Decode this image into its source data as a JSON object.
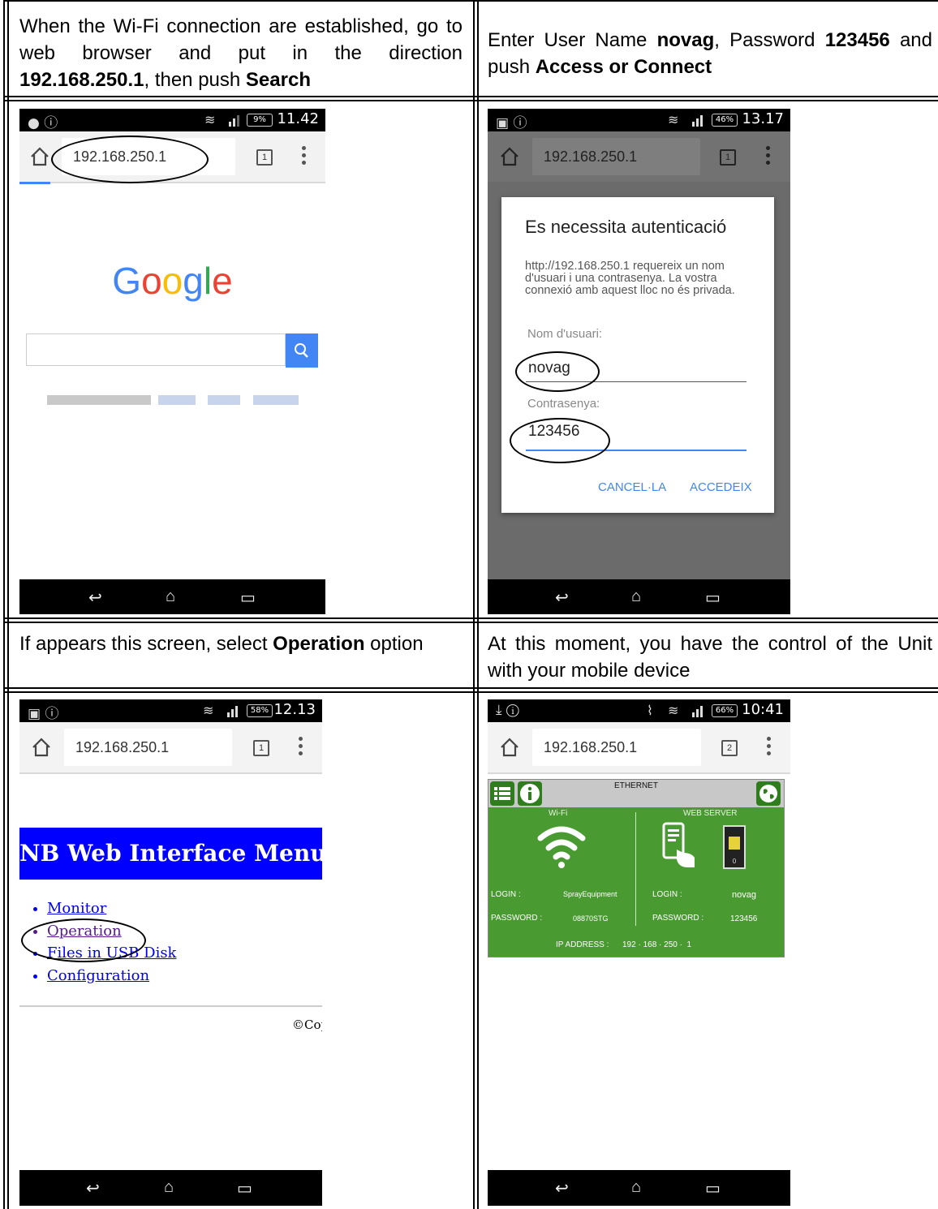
{
  "cells": {
    "c1": {
      "pre": "When the Wi-Fi connection are established, go to web browser and put in the direction ",
      "b1": "192.168.250.1",
      "mid": ", then push ",
      "b2": "Search"
    },
    "c2": {
      "pre": "Enter User Name ",
      "b1": "novag",
      "mid": ", Password ",
      "b2": "123456",
      "mid2": " and push ",
      "b3": "Access or Connect"
    },
    "c3": {
      "pre": "If appears this screen, select ",
      "b1": "Operation",
      "post": " option"
    },
    "c4": {
      "text": "At this moment, you have the control of the Unit with your mobile device"
    }
  },
  "phone1": {
    "time": "11.42",
    "battery": "9%",
    "url": "192.168.250.1",
    "tabs": "1",
    "logo": "Google"
  },
  "phone2": {
    "time": "13.17",
    "battery": "46%",
    "url": "192.168.250.1",
    "tabs": "1",
    "dialog": {
      "title": "Es necessita autenticació",
      "message": "http://192.168.250.1 requereix un nom d'usuari i una contrasenya. La vostra connexió amb aquest lloc no és privada.",
      "user_label": "Nom d'usuari:",
      "user_value": "novag",
      "pass_label": "Contrasenya:",
      "pass_value": "123456",
      "cancel": "CANCEL·LA",
      "accept": "ACCEDEIX"
    }
  },
  "phone3": {
    "time": "12.13",
    "battery": "58%",
    "url": "192.168.250.1",
    "tabs": "1",
    "heading": "NB Web Interface Menu",
    "menu": [
      "Monitor",
      "Operation",
      "Files in USB Disk",
      "Configuration"
    ],
    "footer": "©Cop"
  },
  "phone4": {
    "time": "10:41",
    "battery": "66%",
    "url": "192.168.250.1",
    "tabs": "2",
    "panel": {
      "title": "ETHERNET",
      "wifi_title": "Wi-Fi",
      "server_title": "WEB SERVER",
      "login_label": "LOGIN :",
      "password_label": "PASSWORD :",
      "wifi_login": "SprayEquipment",
      "wifi_password": "08870STG",
      "server_login": "novag",
      "server_password": "123456",
      "ip_label": "IP ADDRESS :",
      "ip_value": "192 · 168 · 250 ·  1",
      "switch_value": "0"
    }
  }
}
